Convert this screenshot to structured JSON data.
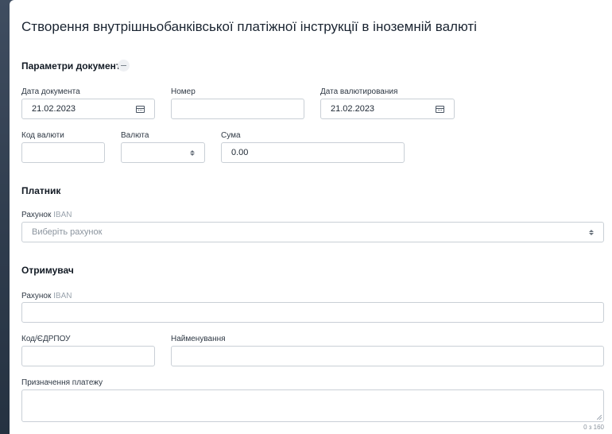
{
  "title": "Створення внутрішньобанківської платіжної інструкції в іноземній валюті",
  "document_params": {
    "heading": "Параметри документа",
    "doc_date": {
      "label": "Дата документа",
      "value": "21.02.2023"
    },
    "number": {
      "label": "Номер",
      "value": ""
    },
    "value_date": {
      "label": "Дата валютирования",
      "value": "21.02.2023"
    },
    "currency_code": {
      "label": "Код валюти",
      "value": ""
    },
    "currency": {
      "label": "Валюта",
      "value": ""
    },
    "amount": {
      "label": "Сума",
      "value": "0.00"
    }
  },
  "payer": {
    "heading": "Платник",
    "account_label": "Рахунок",
    "account_hint": "IBAN",
    "account_placeholder": "Виберіть рахунок"
  },
  "recipient": {
    "heading": "Отримувач",
    "account_label": "Рахунок",
    "account_hint": "IBAN",
    "code_label": "Код/ЄДРПОУ",
    "name_label": "Найменування"
  },
  "purpose": {
    "label": "Призначення платежу",
    "counter": "0 з 160"
  },
  "icons": {
    "calendar": "calendar-icon",
    "select": "select-arrows-icon",
    "collapse": "minus-icon"
  }
}
